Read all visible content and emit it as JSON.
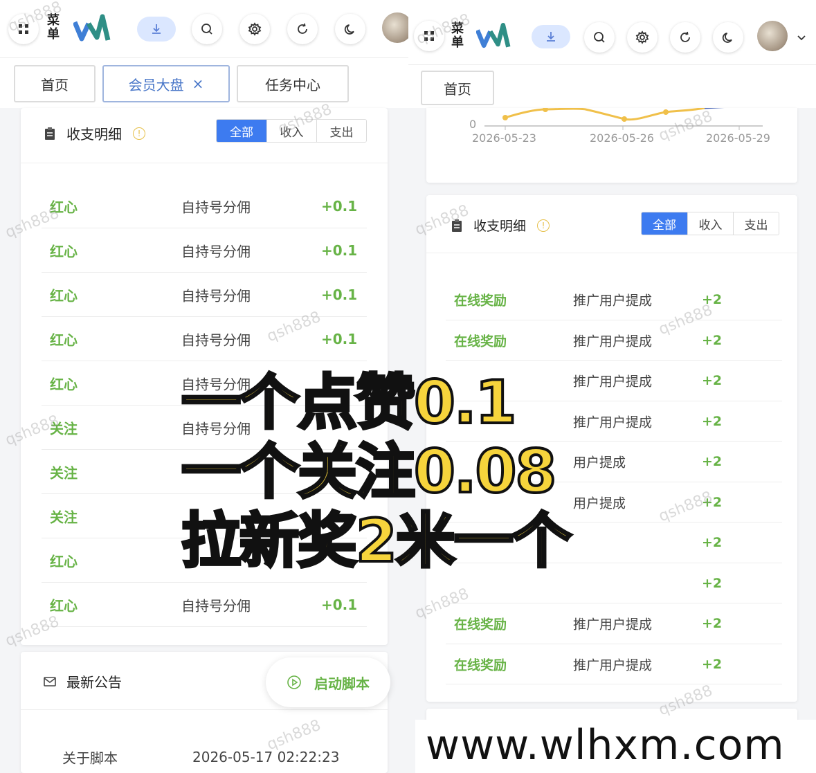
{
  "topbar": {
    "menu_label": "菜单",
    "icons": [
      "grid-icon",
      "download-icon",
      "search-icon",
      "gear-icon",
      "refresh-icon",
      "moon-icon"
    ]
  },
  "left": {
    "tabs": [
      {
        "label": "首页"
      },
      {
        "label": "会员大盘",
        "close": "×"
      },
      {
        "label": "任务中心"
      }
    ],
    "ledger": {
      "title": "收支明细",
      "info": "!",
      "filters": [
        "全部",
        "收入",
        "支出"
      ],
      "rows": [
        {
          "type": "红心",
          "desc": "自持号分佣",
          "amount": "+0.1"
        },
        {
          "type": "红心",
          "desc": "自持号分佣",
          "amount": "+0.1"
        },
        {
          "type": "红心",
          "desc": "自持号分佣",
          "amount": "+0.1"
        },
        {
          "type": "红心",
          "desc": "自持号分佣",
          "amount": "+0.1"
        },
        {
          "type": "红心",
          "desc": "自持号分佣",
          "amount": ""
        },
        {
          "type": "关注",
          "desc": "自持号分佣",
          "amount": ""
        },
        {
          "type": "关注",
          "desc": "",
          "amount": ""
        },
        {
          "type": "关注",
          "desc": "",
          "amount": ""
        },
        {
          "type": "红心",
          "desc": "",
          "amount": ""
        },
        {
          "type": "红心",
          "desc": "自持号分佣",
          "amount": "+0.1"
        }
      ]
    },
    "notice": {
      "title": "最新公告",
      "start_script": "启动脚本",
      "item_title": "关于脚本",
      "item_time": "2026-05-17 02:22:23"
    }
  },
  "right": {
    "tabs": [
      {
        "label": "首页"
      }
    ],
    "chart_axis": {
      "zero": "0",
      "dates": [
        "2026-05-23",
        "2026-05-26",
        "2026-05-29"
      ]
    },
    "ledger": {
      "title": "收支明细",
      "info": "!",
      "filters": [
        "全部",
        "收入",
        "支出"
      ],
      "rows": [
        {
          "type": "在线奖励",
          "desc": "推广用户提成",
          "amount": "+2"
        },
        {
          "type": "在线奖励",
          "desc": "推广用户提成",
          "amount": "+2"
        },
        {
          "type": "",
          "desc": "推广用户提成",
          "amount": "+2"
        },
        {
          "type": "",
          "desc": "推广用户提成",
          "amount": "+2"
        },
        {
          "type": "",
          "desc": "用户提成",
          "amount": "+2"
        },
        {
          "type": "",
          "desc": "用户提成",
          "amount": "+2"
        },
        {
          "type": "",
          "desc": "",
          "amount": "+2"
        },
        {
          "type": "",
          "desc": "",
          "amount": "+2"
        },
        {
          "type": "在线奖励",
          "desc": "推广用户提成",
          "amount": "+2"
        },
        {
          "type": "在线奖励",
          "desc": "推广用户提成",
          "amount": "+2"
        }
      ]
    }
  },
  "overlay": {
    "line1": "一个点赞0.1",
    "line2": "一个关注0.08",
    "line3": "拉新奖2米一个"
  },
  "watermark": "qsh888",
  "site": "www.wlhxm.com",
  "colors": {
    "accent": "#3d7bf0",
    "green": "#67b346",
    "overlay_yellow": "#f6d43c"
  }
}
